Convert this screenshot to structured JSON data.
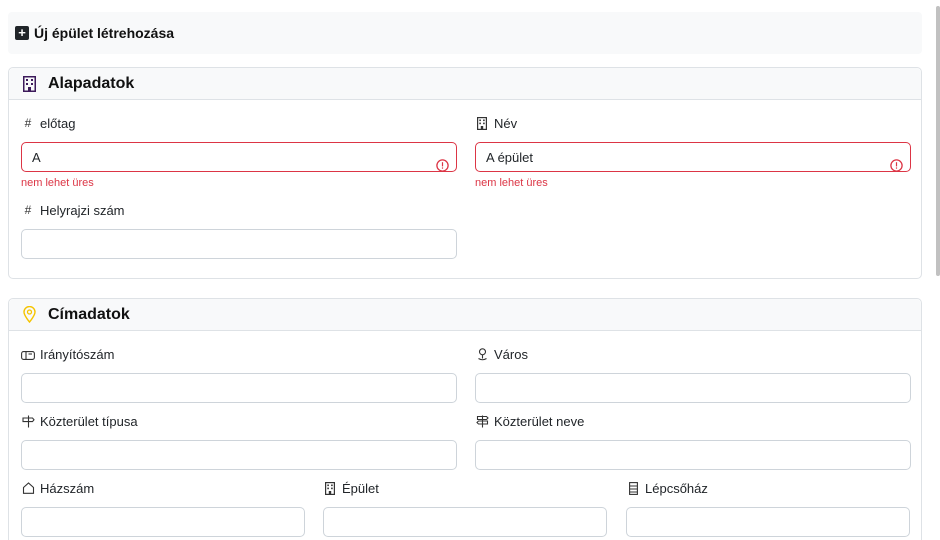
{
  "header": {
    "icon": "plus-square-icon",
    "title": "Új épület létrehozása"
  },
  "basic_card": {
    "icon": "building-icon",
    "icon_color": "#3d1a5b",
    "title": "Alapadatok",
    "fields": {
      "prefix": {
        "label": "előtag",
        "icon": "hash-icon",
        "value": "A",
        "error": "nem lehet üres"
      },
      "name": {
        "label": "Név",
        "icon": "building-icon",
        "value": "A épület",
        "error": "nem lehet üres"
      },
      "lot_number": {
        "label": "Helyrajzi szám",
        "icon": "hash-icon",
        "value": ""
      }
    }
  },
  "address_card": {
    "icon": "map-pin-icon",
    "icon_color": "#f5c400",
    "title": "Címadatok",
    "fields": {
      "postal_code": {
        "label": "Irányítószám",
        "icon": "mailbox-icon",
        "value": ""
      },
      "city": {
        "label": "Város",
        "icon": "person-pin-icon",
        "value": ""
      },
      "street_type": {
        "label": "Közterület típusa",
        "icon": "signpost-icon",
        "value": ""
      },
      "street_name": {
        "label": "Közterület neve",
        "icon": "signpost-split-icon",
        "value": ""
      },
      "house_number": {
        "label": "Házszám",
        "icon": "house-icon",
        "value": ""
      },
      "building": {
        "label": "Épület",
        "icon": "building-icon",
        "value": ""
      },
      "staircase": {
        "label": "Lépcsőház",
        "icon": "staircase-icon",
        "value": ""
      }
    }
  },
  "colors": {
    "error": "#dc3545",
    "border": "#ced4da",
    "header_bg": "#f8f9fa"
  }
}
